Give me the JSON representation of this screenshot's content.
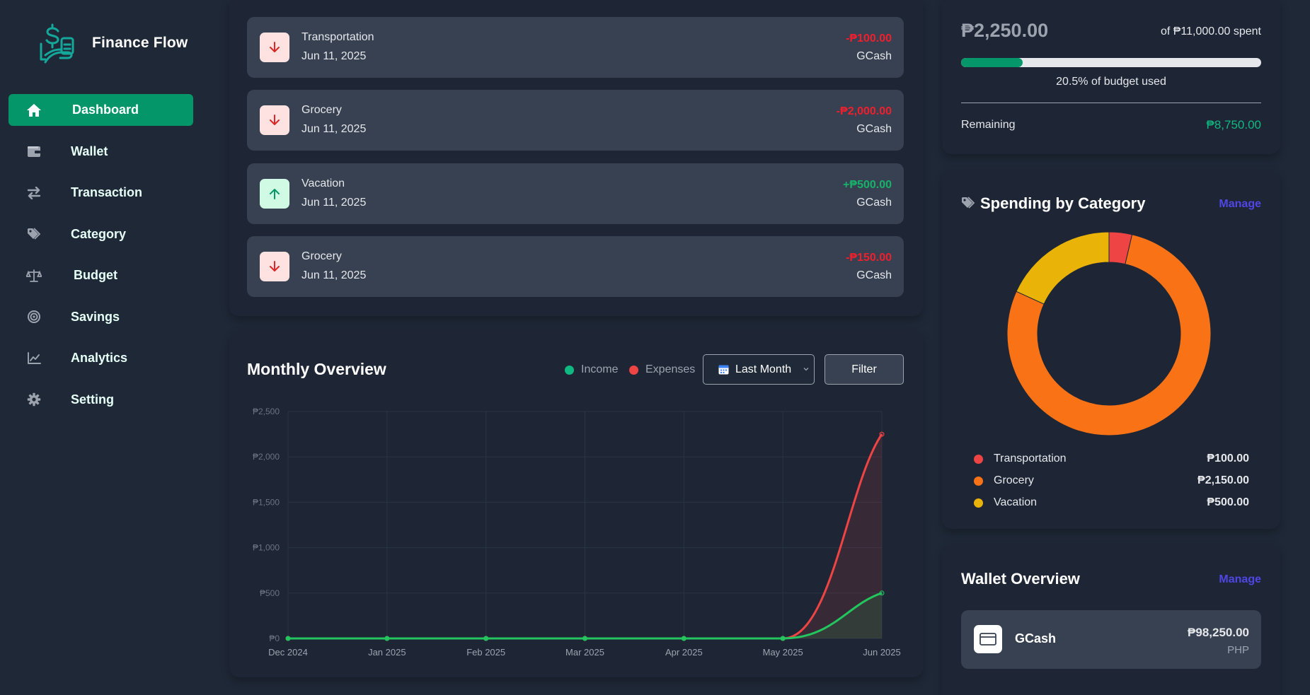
{
  "app": {
    "name": "Finance Flow",
    "logo_icon": "money-hand-icon"
  },
  "sidebar": {
    "items": [
      {
        "label": "Dashboard",
        "icon": "home-icon",
        "active": true
      },
      {
        "label": "Wallet",
        "icon": "wallet-icon"
      },
      {
        "label": "Transaction",
        "icon": "arrows-exchange-icon"
      },
      {
        "label": "Category",
        "icon": "tags-icon"
      },
      {
        "label": "Budget",
        "icon": "scale-icon"
      },
      {
        "label": "Savings",
        "icon": "target-icon"
      },
      {
        "label": "Analytics",
        "icon": "chart-line-icon"
      },
      {
        "label": "Setting",
        "icon": "gear-icon"
      }
    ]
  },
  "transactions": [
    {
      "name": "Transportation",
      "date": "Jun 11, 2025",
      "amount": "-₱100.00",
      "wallet": "GCash",
      "direction": "down"
    },
    {
      "name": "Grocery",
      "date": "Jun 11, 2025",
      "amount": "-₱2,000.00",
      "wallet": "GCash",
      "direction": "down"
    },
    {
      "name": "Vacation",
      "date": "Jun 11, 2025",
      "amount": "+₱500.00",
      "wallet": "GCash",
      "direction": "up"
    },
    {
      "name": "Grocery",
      "date": "Jun 11, 2025",
      "amount": "-₱150.00",
      "wallet": "GCash",
      "direction": "down"
    }
  ],
  "overview": {
    "title": "Monthly Overview",
    "legend": {
      "income": "Income",
      "expenses": "Expenses"
    },
    "period_select": "Last Month",
    "filter_label": "Filter"
  },
  "chart_data": {
    "type": "line",
    "x": [
      "Dec 2024",
      "Jan 2025",
      "Feb 2025",
      "Mar 2025",
      "Apr 2025",
      "May 2025",
      "Jun 2025"
    ],
    "yticks": [
      "₱0",
      "₱500",
      "₱1,000",
      "₱1,500",
      "₱2,000",
      "₱2,500"
    ],
    "ylim": [
      0,
      2500
    ],
    "grid": true,
    "series": [
      {
        "name": "Income",
        "color": "#22c55e",
        "values": [
          0,
          0,
          0,
          0,
          0,
          0,
          500
        ]
      },
      {
        "name": "Expenses",
        "color": "#ef4444",
        "values": [
          0,
          0,
          0,
          0,
          0,
          0,
          2250
        ]
      }
    ]
  },
  "budget": {
    "spent": "₱2,250.00",
    "of_total": "of ₱11,000.00 spent",
    "used_fraction": 0.205,
    "used_text": "20.5% of budget used",
    "remaining_label": "Remaining",
    "remaining_value": "₱8,750.00"
  },
  "spending": {
    "title": "Spending by Category",
    "manage_label": "Manage",
    "categories": [
      {
        "name": "Transportation",
        "value": "₱100.00",
        "amount": 100,
        "color": "#ef4444"
      },
      {
        "name": "Grocery",
        "value": "₱2,150.00",
        "amount": 2150,
        "color": "#f97316"
      },
      {
        "name": "Vacation",
        "value": "₱500.00",
        "amount": 500,
        "color": "#eab308"
      }
    ]
  },
  "wallets": {
    "title": "Wallet Overview",
    "manage_label": "Manage",
    "items": [
      {
        "name": "GCash",
        "balance": "₱98,250.00",
        "currency": "PHP"
      }
    ]
  },
  "colors": {
    "accent": "#049669",
    "link": "#4f46e5",
    "income": "#22c55e",
    "expense": "#ef4444"
  }
}
